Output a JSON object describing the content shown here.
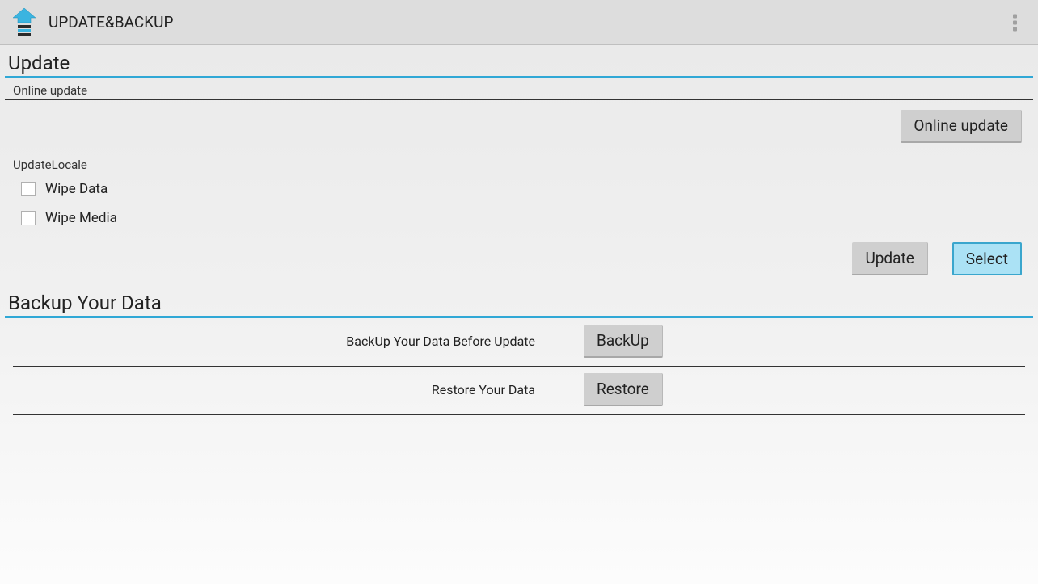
{
  "header": {
    "title": "UPDATE&BACKUP"
  },
  "update": {
    "section_title": "Update",
    "online_update_label": "Online update",
    "online_update_button": "Online update",
    "locale_label": "UpdateLocale",
    "wipe_data_label": "Wipe Data",
    "wipe_media_label": "Wipe Media",
    "update_button": "Update",
    "select_button": "Select"
  },
  "backup": {
    "section_title": "Backup Your Data",
    "backup_text": "BackUp Your Data Before Update",
    "backup_button": "BackUp",
    "restore_text": "Restore Your Data",
    "restore_button": "Restore"
  }
}
